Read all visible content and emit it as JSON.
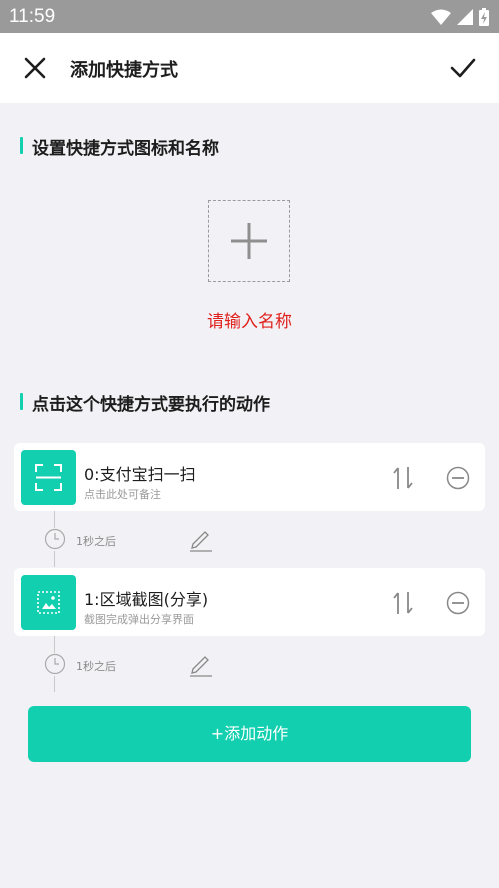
{
  "status_bar": {
    "time": "11:59"
  },
  "toolbar": {
    "title": "添加快捷方式"
  },
  "section_icon": {
    "title": "设置快捷方式图标和名称"
  },
  "name_input": {
    "placeholder": "请输入名称"
  },
  "section_actions": {
    "title": "点击这个快捷方式要执行的动作"
  },
  "actions": [
    {
      "name": "0:支付宝扫一扫",
      "note": "点击此处可备注",
      "delay": "1秒之后"
    },
    {
      "name": "1:区域截图(分享)",
      "note": "截图完成弹出分享界面",
      "delay": "1秒之后"
    }
  ],
  "add_button": {
    "label": "+添加动作"
  },
  "colors": {
    "accent": "#12cfb0",
    "warning_text": "#e0201c"
  }
}
